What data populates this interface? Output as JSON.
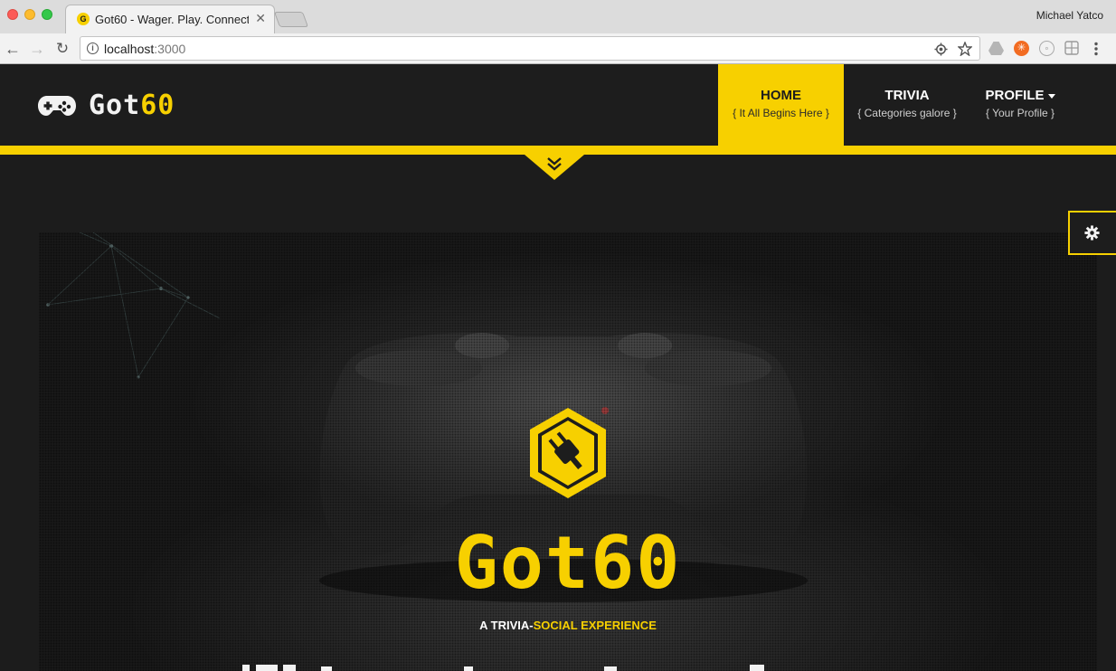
{
  "browser": {
    "tab_title": "Got60 - Wager. Play. Connect.",
    "tab_favicon_letter": "G",
    "tab_close": "✕",
    "user_name": "Michael Yatco",
    "url_host": "localhost",
    "url_port": ":3000",
    "back_glyph": "←",
    "forward_glyph": "→",
    "reload_glyph": "↻"
  },
  "site": {
    "logo_white": "Got",
    "logo_yellow": "60",
    "nav": [
      {
        "label": "HOME",
        "sub": "{  It All Begins Here  }",
        "active": true
      },
      {
        "label": "TRIVIA",
        "sub": "{  Categories galore  }",
        "active": false
      },
      {
        "label": "PROFILE",
        "sub": "{  Your Profile  }",
        "active": false
      }
    ]
  },
  "hero": {
    "logo": "Got60",
    "tagline_white": "A TRIVIA-",
    "tagline_yellow": "SOCIAL EXPERIENCE"
  },
  "icons": {
    "controller": "gamepad-icon",
    "settings": "gear-icon",
    "scroll": "double-chevron-down-icon",
    "emblem": "plug-icon"
  },
  "colors": {
    "accent": "#f7d000",
    "header_bg": "#1d1d1d",
    "page_bg": "#1c1c1c"
  }
}
